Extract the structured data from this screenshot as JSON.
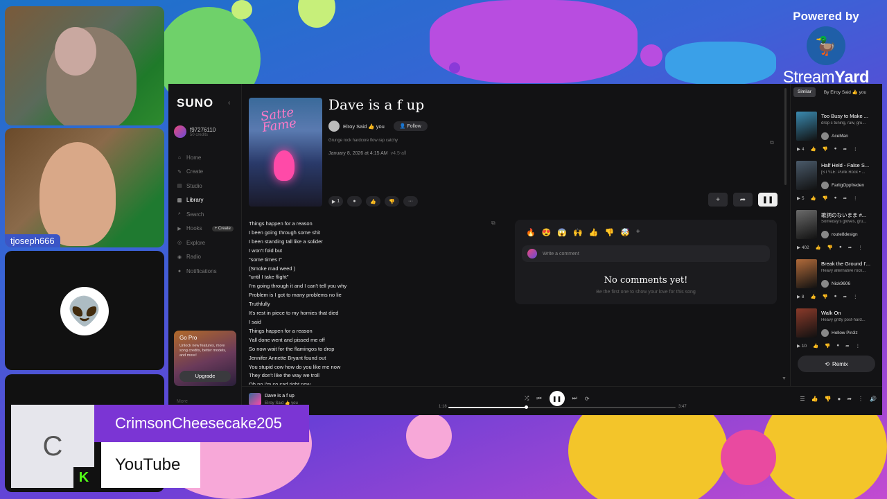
{
  "webcams": [
    {
      "name_tag": ""
    },
    {
      "name_tag": "tjoseph666"
    },
    {
      "avatar": "alien-icon"
    },
    {
      "avatar": ""
    }
  ],
  "branding": {
    "powered_by": "Powered by",
    "name_regular": "Stream",
    "name_bold": "Yard"
  },
  "suno": {
    "logo": "SUNO",
    "user": {
      "name": "f97276110",
      "credits": "50 credits"
    },
    "nav": [
      {
        "label": "Home",
        "icon": "home-icon",
        "glyph": "⌂"
      },
      {
        "label": "Create",
        "icon": "create-icon",
        "glyph": "✎"
      },
      {
        "label": "Studio",
        "icon": "studio-icon",
        "glyph": "▤"
      },
      {
        "label": "Library",
        "icon": "library-icon",
        "glyph": "▥",
        "active": true
      },
      {
        "label": "Search",
        "icon": "search-icon",
        "glyph": "⌕"
      },
      {
        "label": "Hooks",
        "icon": "hooks-icon",
        "glyph": "▶"
      },
      {
        "label": "Explore",
        "icon": "explore-icon",
        "glyph": "◎"
      },
      {
        "label": "Radio",
        "icon": "radio-icon",
        "glyph": "◉"
      },
      {
        "label": "Notifications",
        "icon": "bell-icon",
        "glyph": "●"
      }
    ],
    "create_pill": "+ Create",
    "gopro": {
      "title": "Go Pro",
      "desc": "Unlock new features, more song credits, better models, and more!",
      "button": "Upgrade"
    },
    "more": "More",
    "song": {
      "art_text": "Satte Fame",
      "title": "Dave is a f up",
      "artist": "Elroy Said 👍 you",
      "follow": "Follow",
      "tags": "Grunge rock hardcore flow rap catchy",
      "date": "January 8, 2026 at 4:15 AM",
      "version": "v4.5-all",
      "play_count": "1"
    },
    "lyrics": [
      "Things happen for a reason",
      "I been going through some shit",
      "I been standing tall  like a solider",
      "I won't fold but",
      "\"some times I\"",
      "(Smoke mad weed )",
      "\"until I take flight\"",
      "I'm going through it and I can't tell you why",
      "Problem is I got to many problems no lie",
      "Truthfully",
      "It's rest in piece to my homies that died",
      "I said",
      "Things happen for a reason",
      "Yall done went and pissed me off",
      "So now wait for the flamingos to drop",
      "Jennifer Annette Bryant found out",
      "You stupid cow how do you like me now",
      "They don't like the way we troll",
      "Oh no I'm so sad right now"
    ],
    "comments": {
      "emojis": [
        "🔥",
        "😍",
        "😱",
        "🙌",
        "👍",
        "👎",
        "🤯"
      ],
      "placeholder": "Write a comment",
      "empty_title": "No comments yet!",
      "empty_sub": "Be the first one to show your love for this song"
    },
    "right_panel": {
      "tabs": [
        "Similar",
        "By Elroy Said 👍 you"
      ],
      "items": [
        {
          "title": "Too Busy to Make ...",
          "desc": "drop c tuning, raw, gru...",
          "artist": "AceMan",
          "plays": "4",
          "thumb": "#3a8ab0"
        },
        {
          "title": "Half Held - False S...",
          "desc": "[STYLE: Punk Rock • ...",
          "artist": "FarligOppfreden",
          "plays": "5",
          "thumb": "#4a5a6a"
        },
        {
          "title": "歌詞のないまま #...",
          "desc": "Someday's gloves, gru...",
          "artist": "route8design",
          "plays": "402",
          "thumb": "#6a6a6a"
        },
        {
          "title": "Break the Ground I'...",
          "desc": "Heavy alternative rock...",
          "artist": "Nick9606",
          "plays": "8",
          "thumb": "#b06a3a"
        },
        {
          "title": "Walk On",
          "desc": "Heavy gritty post-hard...",
          "artist": "Hollow Pin3z",
          "plays": "10",
          "thumb": "#8a3a2a"
        }
      ],
      "remix": "Remix"
    },
    "player": {
      "title": "Dave is a f up",
      "artist": "Elroy Said 👍 you",
      "elapsed": "1:18",
      "duration": "3:47",
      "progress": 0.34
    }
  },
  "banner": {
    "avatar_letter": "C",
    "badge": "K",
    "name": "CrimsonCheesecake205",
    "platform": "YouTube"
  }
}
